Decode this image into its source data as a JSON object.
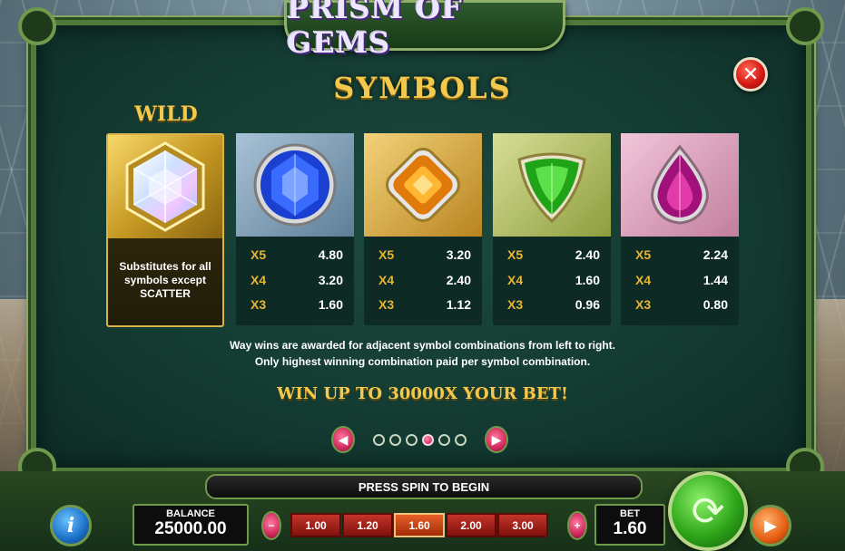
{
  "header": {
    "logo_text": "PRISM OF GEMS"
  },
  "dialog": {
    "title": "SYMBOLS",
    "close_icon": "close-x-icon"
  },
  "wild": {
    "label": "WILD",
    "icon": "hexagon-diamond-icon",
    "description_lines": [
      "Substitutes for all",
      "symbols except",
      "SCATTER"
    ]
  },
  "symbols": [
    {
      "icon": "blue-round-gem-icon",
      "bg": "#6f8fa8",
      "payouts": [
        {
          "mult": "X5",
          "value": "4.80"
        },
        {
          "mult": "X4",
          "value": "3.20"
        },
        {
          "mult": "X3",
          "value": "1.60"
        }
      ]
    },
    {
      "icon": "orange-square-gem-icon",
      "bg": "#d7a93c",
      "payouts": [
        {
          "mult": "X5",
          "value": "3.20"
        },
        {
          "mult": "X4",
          "value": "2.40"
        },
        {
          "mult": "X3",
          "value": "1.12"
        }
      ]
    },
    {
      "icon": "green-triangle-gem-icon",
      "bg": "#b6c46a",
      "payouts": [
        {
          "mult": "X5",
          "value": "2.40"
        },
        {
          "mult": "X4",
          "value": "1.60"
        },
        {
          "mult": "X3",
          "value": "0.96"
        }
      ]
    },
    {
      "icon": "pink-drop-gem-icon",
      "bg": "#e2a6c2",
      "payouts": [
        {
          "mult": "X5",
          "value": "2.24"
        },
        {
          "mult": "X4",
          "value": "1.44"
        },
        {
          "mult": "X3",
          "value": "0.80"
        }
      ]
    }
  ],
  "info": {
    "line1": "Way wins are awarded for adjacent symbol combinations from left to right.",
    "line2": "Only highest winning combination paid per symbol combination."
  },
  "win_up": "WIN UP TO 30000X YOUR BET!",
  "pager": {
    "page_count": 6,
    "active_index": 4
  },
  "bottom_bar": {
    "message": "PRESS SPIN TO BEGIN",
    "info_glyph": "i",
    "balance_label": "BALANCE",
    "balance_value": "25000.00",
    "bet_decrease_glyph": "−",
    "bet_increase_glyph": "+",
    "bet_options": [
      "1.00",
      "1.20",
      "1.60",
      "2.00",
      "3.00"
    ],
    "selected_bet_index": 2,
    "bet_label": "BET",
    "bet_value": "1.60"
  },
  "colors": {
    "accent_gold": "#f2c94c",
    "panel_green": "#133a31",
    "frame_green": "#4f7a3a"
  }
}
